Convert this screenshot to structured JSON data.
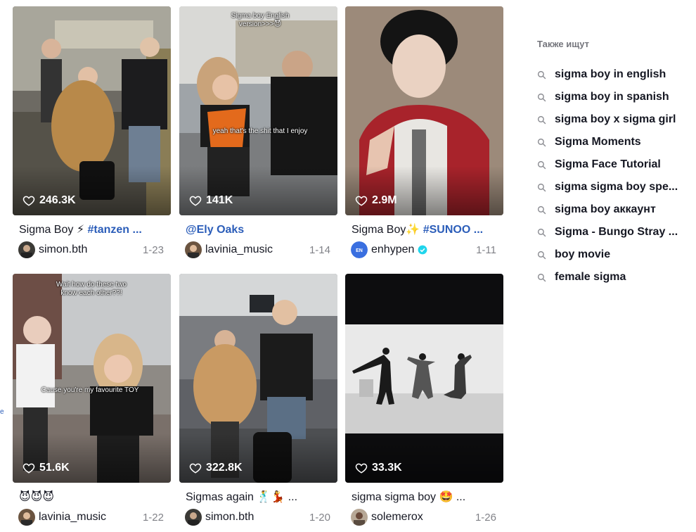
{
  "videos": [
    {
      "likes": "246.3K",
      "desc_text": "Sigma Boy ⚡ ",
      "desc_tag": "#tanzen ...",
      "user": "simon.bth",
      "date": "1-23",
      "overlay": ""
    },
    {
      "likes": "141K",
      "desc_text": "",
      "desc_tag": "@Ely Oaks",
      "user": "lavinia_music",
      "date": "1-14",
      "overlay_top": "Sigma boy English version>>>😈",
      "overlay_mid": "yeah that's the shit that I enjoy"
    },
    {
      "likes": "2.9M",
      "desc_text": "Sigma Boy✨ ",
      "desc_tag": "#SUNOO ...",
      "user": "enhypen",
      "date": "1-11"
    },
    {
      "likes": "51.6K",
      "desc_text": "😈😈😈",
      "desc_tag": "",
      "user": "lavinia_music",
      "date": "1-22",
      "overlay_top": "Wait how do these two know each other??!",
      "overlay_mid": "Cause you're my favourite TOY"
    },
    {
      "likes": "322.8K",
      "desc_text": "Sigmas again 🕺💃 ...",
      "desc_tag": "",
      "user": "simon.bth",
      "date": "1-20"
    },
    {
      "likes": "33.3K",
      "desc_text": "sigma sigma boy 🤩 ...",
      "desc_tag": "",
      "user": "solemerox",
      "date": "1-26"
    }
  ],
  "sidebar": {
    "title": "Также ищут",
    "items": [
      "sigma boy in english",
      "sigma boy in spanish",
      "sigma boy x sigma girl",
      "Sigma Moments",
      "Sigma Face Tutorial",
      "sigma sigma boy spe...",
      "sigma boy аккаунт",
      "Sigma - Bungo Stray ...",
      "boy movie",
      "female sigma"
    ]
  },
  "colors": {
    "hashtag": "#2b5db9",
    "verified": "#20d5ec",
    "text": "#161823"
  },
  "icons": [
    "heart-icon",
    "search-icon",
    "verified-badge-icon"
  ]
}
